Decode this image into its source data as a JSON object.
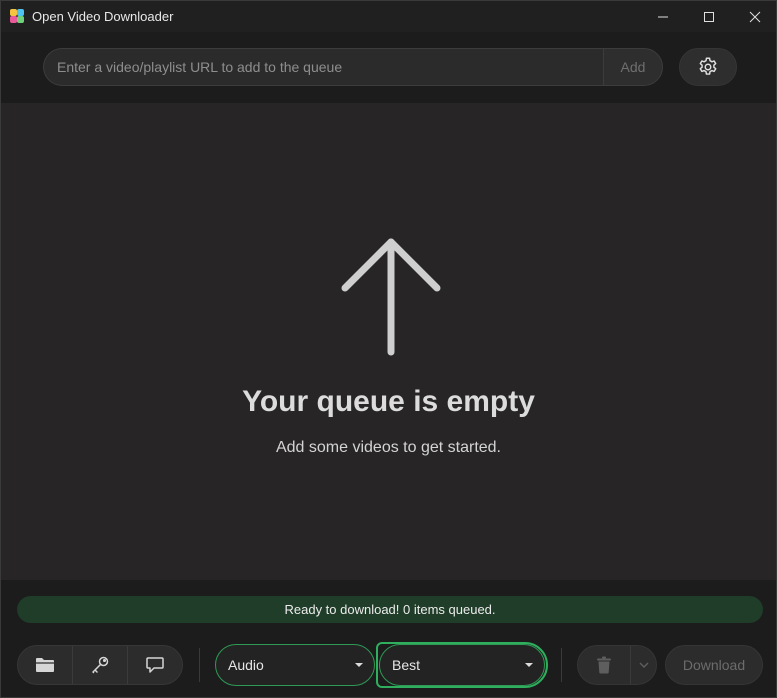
{
  "window": {
    "title": "Open Video Downloader",
    "controls": [
      "minimize-icon",
      "maximize-icon",
      "close-icon"
    ]
  },
  "url_bar": {
    "placeholder": "Enter a video/playlist URL to add to the queue",
    "value": "",
    "add_label": "Add",
    "settings_icon": "gear-icon"
  },
  "queue": {
    "empty_icon": "arrow-up-icon",
    "empty_title": "Your queue is empty",
    "empty_subtitle": "Add some videos to get started."
  },
  "status": {
    "text": "Ready to download! 0 items queued."
  },
  "toolbar": {
    "left_icons": [
      "folder-icon",
      "key-icon",
      "chat-icon"
    ],
    "type_select": "Audio",
    "quality_select": "Best",
    "trash_icon": "trash-icon",
    "download_label": "Download"
  },
  "colors": {
    "accent_green": "#2fae5e",
    "status_bg": "#1f3d28",
    "main_bg": "#272525"
  }
}
